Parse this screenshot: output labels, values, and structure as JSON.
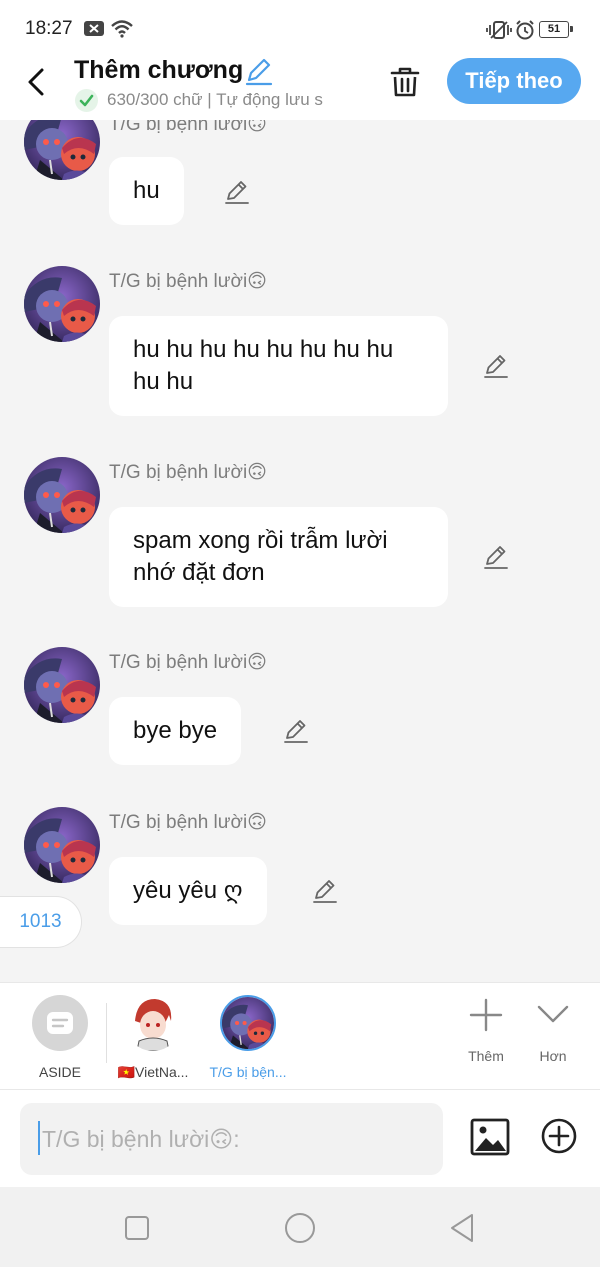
{
  "status_bar": {
    "time": "18:27",
    "battery": "51"
  },
  "header": {
    "title": "Thêm chương",
    "subtitle": "630/300 chữ | Tự động lưu s",
    "next_button": "Tiếp theo"
  },
  "messages": [
    {
      "sender": "T/G bị bệnh lười🙃",
      "text": "hu"
    },
    {
      "sender": "T/G bị bệnh lười🙃",
      "lines": [
        "hu hu hu hu hu hu hu hu",
        "hu hu"
      ]
    },
    {
      "sender": "T/G bị bệnh lười🙃",
      "lines": [
        "spam xong rồi trẫm lười",
        "nhớ đặt đơn"
      ]
    },
    {
      "sender": "T/G bị bệnh lười🙃",
      "text": "bye bye"
    },
    {
      "sender": "T/G bị bệnh lười🙃",
      "text": "yêu yêu ღ"
    }
  ],
  "word_count_badge": "1013",
  "character_bar": {
    "characters": [
      {
        "label": "ASIDE"
      },
      {
        "label": "🇻🇳VietNa..."
      },
      {
        "label": "T/G bị bện..."
      }
    ],
    "add_label": "Thêm",
    "more_label": "Hơn"
  },
  "input": {
    "placeholder": "T/G bị bệnh lười🙃:"
  },
  "colors": {
    "accent": "#57a8f0",
    "link": "#4a9de8",
    "background": "#f4f4f4"
  }
}
